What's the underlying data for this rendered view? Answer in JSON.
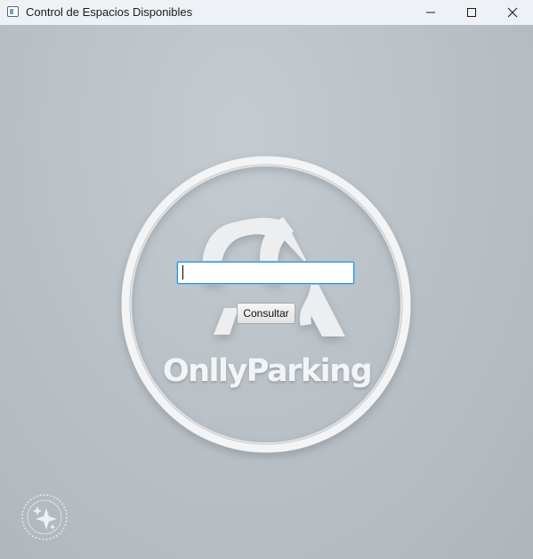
{
  "window": {
    "title": "Control de Espacios Disponibles",
    "icon": "app-window-icon",
    "buttons": {
      "minimize": "minimize-icon",
      "maximize": "maximize-icon",
      "close": "close-icon"
    }
  },
  "background": {
    "logo_icon": "parking-logo-mark",
    "brand": "OnllyParking",
    "watermark_icon": "sparkle-watermark-icon"
  },
  "form": {
    "input_value": "",
    "button_label": "Consultar"
  },
  "colors": {
    "background": "#bcc4ca",
    "ring": "#f2f3f4",
    "input_focus": "#2c8fd6"
  }
}
